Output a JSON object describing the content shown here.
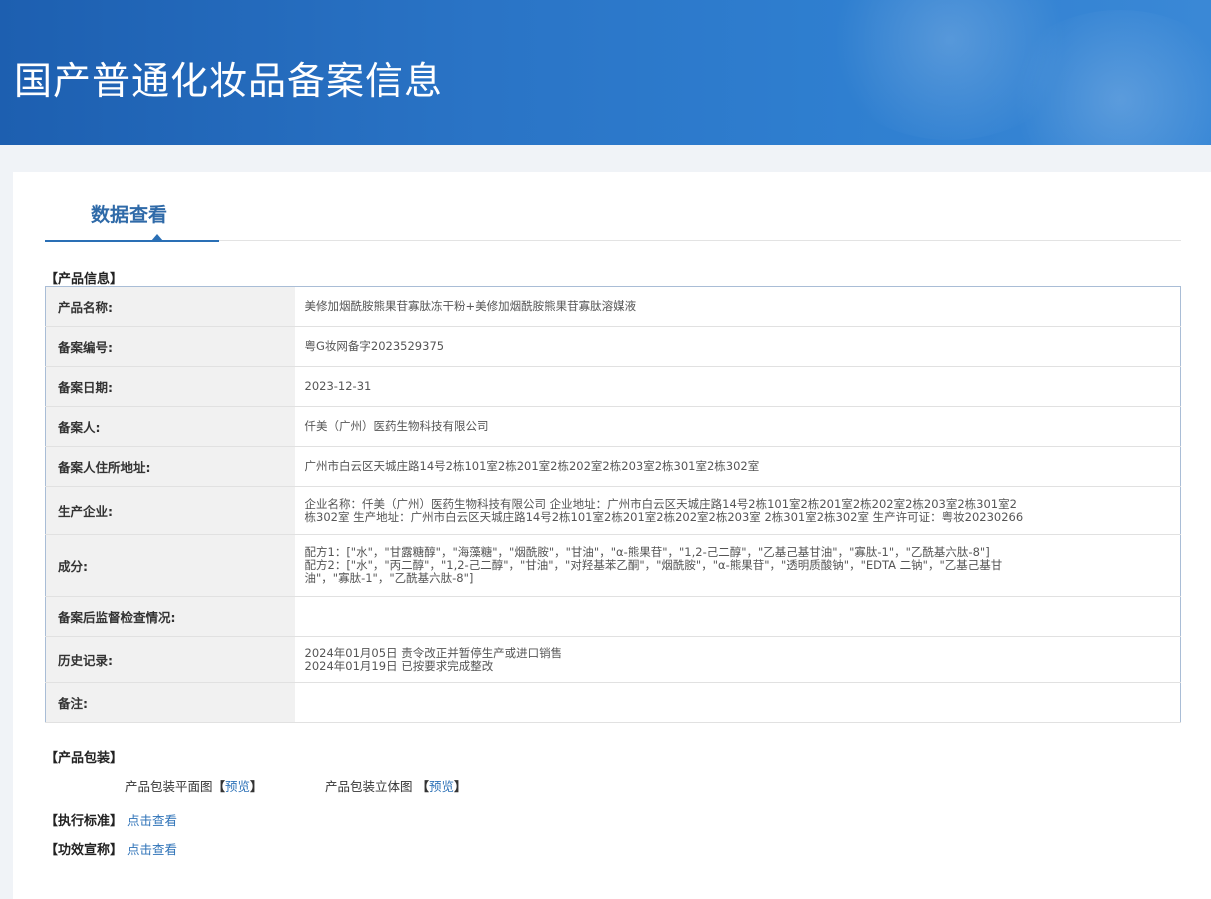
{
  "header": {
    "title": "国产普通化妆品备案信息"
  },
  "tabs": {
    "active_label": "数据查看"
  },
  "product_info": {
    "section_title": "【产品信息】",
    "rows": [
      {
        "label": "产品名称:",
        "value": [
          "美修加烟酰胺熊果苷寡肽冻干粉+美修加烟酰胺熊果苷寡肽溶媒液"
        ]
      },
      {
        "label": "备案编号:",
        "value": [
          "粤G妆网备字2023529375"
        ]
      },
      {
        "label": "备案日期:",
        "value": [
          "2023-12-31"
        ]
      },
      {
        "label": "备案人:",
        "value": [
          "仟美（广州）医药生物科技有限公司"
        ]
      },
      {
        "label": "备案人住所地址:",
        "value": [
          "广州市白云区天城庄路14号2栋101室2栋201室2栋202室2栋203室2栋301室2栋302室"
        ]
      },
      {
        "label": "生产企业:",
        "value": [
          "企业名称：仟美（广州）医药生物科技有限公司 企业地址：广州市白云区天城庄路14号2栋101室2栋201室2栋202室2栋203室2栋301室2",
          "栋302室 生产地址：广州市白云区天城庄路14号2栋101室2栋201室2栋202室2栋203室 2栋301室2栋302室 生产许可证：粤妆20230266"
        ]
      },
      {
        "label": "成分:",
        "value": [
          "配方1：[\"水\"，\"甘露糖醇\"，\"海藻糖\"，\"烟酰胺\"，\"甘油\"，\"α-熊果苷\"，\"1,2-己二醇\"，\"乙基己基甘油\"，\"寡肽-1\"，\"乙酰基六肽-8\"]",
          "配方2：[\"水\"，\"丙二醇\"，\"1,2-己二醇\"，\"甘油\"，\"对羟基苯乙酮\"，\"烟酰胺\"，\"α-熊果苷\"，\"透明质酸钠\"，\"EDTA 二钠\"，\"乙基己基甘",
          "油\"，\"寡肽-1\"，\"乙酰基六肽-8\"]"
        ]
      },
      {
        "label": "备案后监督检查情况:",
        "value": []
      },
      {
        "label": "历史记录:",
        "value": [
          "2024年01月05日 责令改正并暂停生产或进口销售",
          "2024年01月19日 已按要求完成整改"
        ]
      },
      {
        "label": "备注:",
        "value": []
      }
    ]
  },
  "packaging": {
    "section_title": "【产品包装】",
    "flat_label": "产品包装平面图",
    "solid_label": "产品包装立体图",
    "preview_link": "预览",
    "bracket_open": "【",
    "bracket_close": "】"
  },
  "standard": {
    "section_title": "【执行标准】",
    "link": "点击查看"
  },
  "efficacy": {
    "section_title": "【功效宣称】",
    "link": "点击查看"
  }
}
